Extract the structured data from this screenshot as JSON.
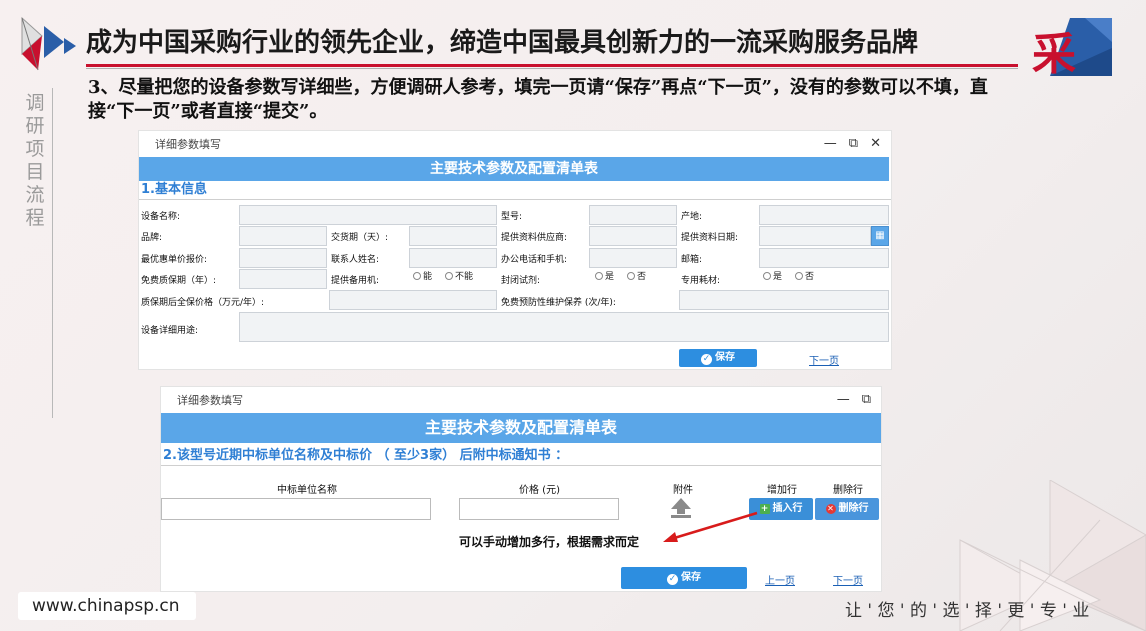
{
  "header": {
    "title": "成为中国采购行业的领先企业，缔造中国最具创新力的一流采购服务品牌",
    "logo_right_char": "采"
  },
  "side_title": "调研项目流程",
  "instruction": "3、尽量把您的设备参数写详细些，方便调研人参考，填完一页请“保存”再点“下一页”，没有的参数可以不填，直接“下一页”或者直接“提交”。",
  "form1": {
    "window_title": "详细参数填写",
    "heading": "主要技术参数及配置清单表",
    "section_title": "1.基本信息",
    "labels": {
      "device_name": "设备名称:",
      "model": "型号:",
      "origin": "产地:",
      "brand": "品牌:",
      "delivery": "交货期（天）:",
      "supplier": "提供资料供应商:",
      "date": "提供资料日期:",
      "best_price": "最优惠单价报价:",
      "contact": "联系人姓名:",
      "phone": "办公电话和手机:",
      "email": "邮箱:",
      "warranty": "免费质保期（年）:",
      "spare": "提供备用机:",
      "sealed": "封闭试剂:",
      "consumable": "专用耗材:",
      "post_warranty": "质保期后全保价格（万元/年）:",
      "maintenance": "免费预防性维护保养 (次/年):",
      "usage": "设备详细用途:"
    },
    "radio": {
      "can": "能",
      "cannot": "不能",
      "yes": "是",
      "no": "否"
    },
    "save_label": "保存",
    "next_label": "下一页"
  },
  "form2": {
    "window_title": "详细参数填写",
    "heading": "主要技术参数及配置清单表",
    "section_title": "2.该型号近期中标单位名称及中标价 （ 至少3家） 后附中标通知书 ：",
    "columns": {
      "unit_name": "中标单位名称",
      "price": "价格 (元)",
      "attachment": "附件",
      "add_row": "增加行",
      "delete_row": "删除行"
    },
    "insert_label": "插入行",
    "delete_label": "删除行",
    "note": "可以手动增加多行，根据需求而定",
    "save_label": "保存",
    "prev_label": "上一页",
    "next_label": "下一页"
  },
  "footer": {
    "url": "www.chinapsp.cn",
    "slogan": "让 ' 您 ' 的 ' 选 ' 择 ' 更 ' 专 ' 业"
  },
  "colors": {
    "accent_red": "#c8102e",
    "form_blue": "#5aa6e8",
    "button_blue": "#2d8ee0"
  }
}
